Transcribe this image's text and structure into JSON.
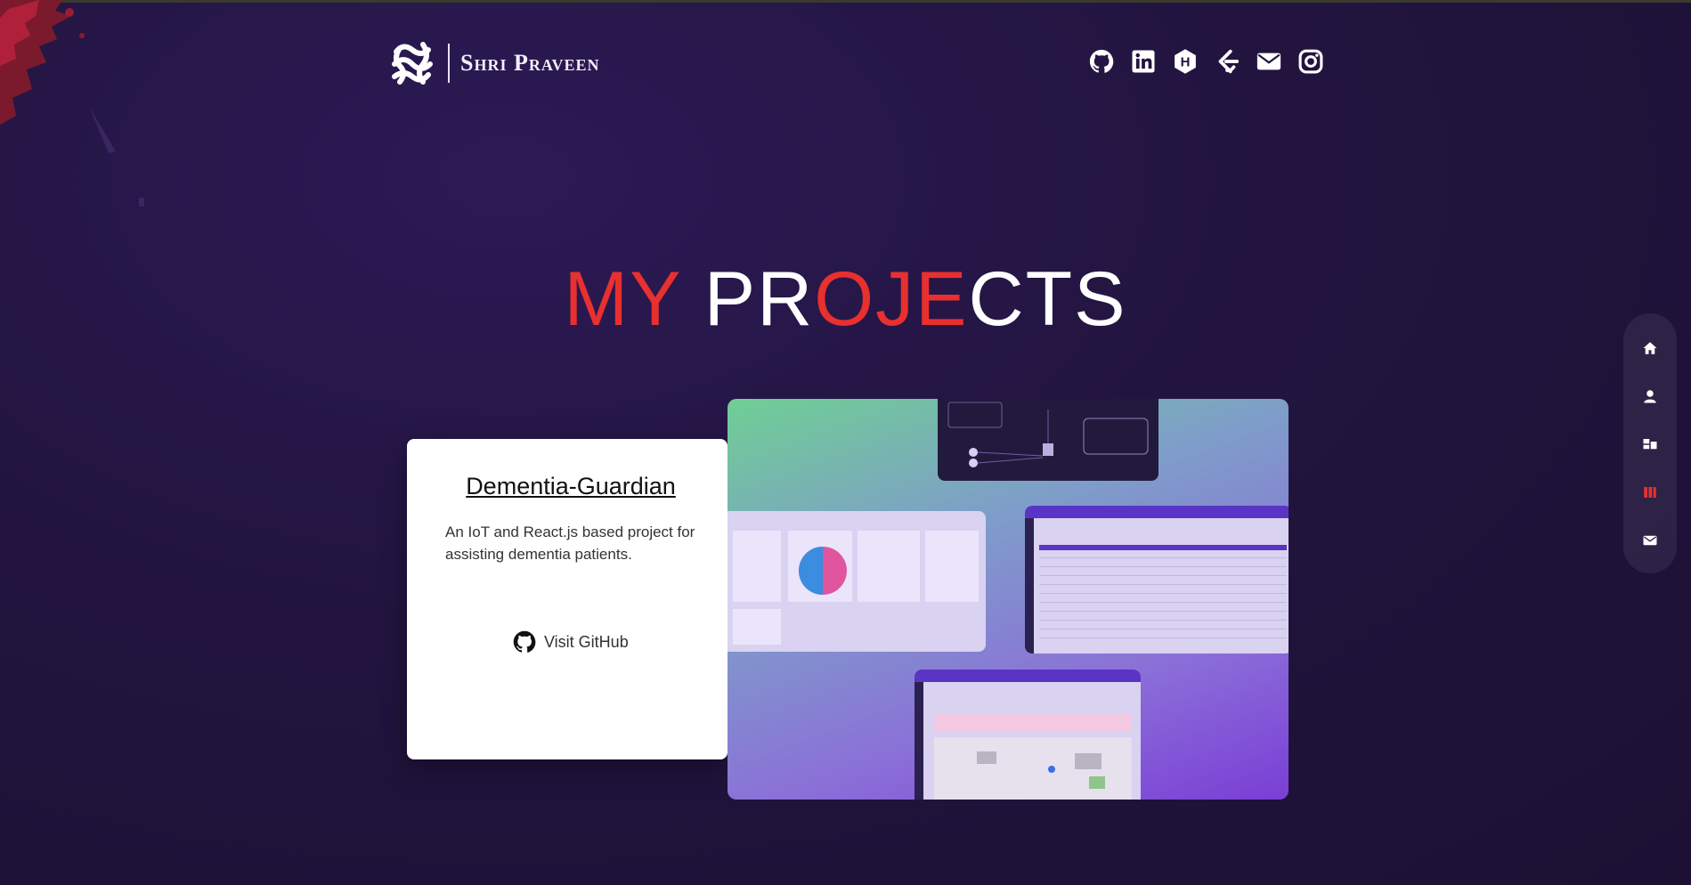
{
  "header": {
    "logo_name": "Shri Praveen",
    "social": [
      {
        "icon": "github-icon"
      },
      {
        "icon": "linkedin-icon"
      },
      {
        "icon": "hashnode-icon"
      },
      {
        "icon": "leetcode-icon"
      },
      {
        "icon": "email-icon"
      },
      {
        "icon": "instagram-icon"
      }
    ]
  },
  "section": {
    "title_parts": [
      "MY",
      " PR",
      "OJE",
      "CTS"
    ]
  },
  "project": {
    "name": "Dementia-Guardian",
    "description": "An IoT and React.js based project for assisting dementia patients.",
    "link_label": "Visit GitHub"
  },
  "side_nav": {
    "items": [
      "home-icon",
      "user-icon",
      "skills-icon",
      "projects-icon",
      "mail-icon"
    ],
    "active": "projects-icon"
  },
  "colors": {
    "accent": "#e8302f",
    "background": "#22143f",
    "card": "#ffffff"
  }
}
